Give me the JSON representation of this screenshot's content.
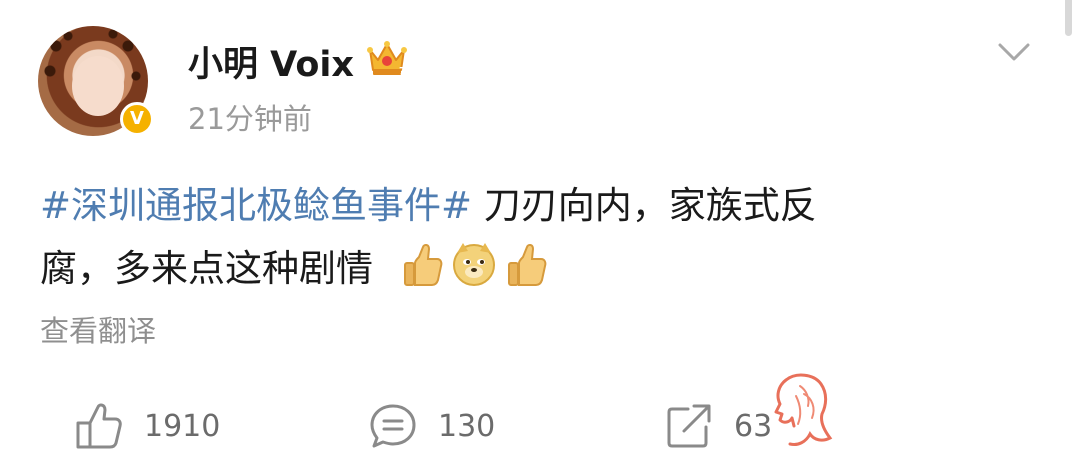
{
  "post": {
    "author": {
      "name": "小明 Voix",
      "verified_badge": "V",
      "crown_icon": "crown-icon"
    },
    "timestamp": "21分钟前",
    "content": {
      "hashtag": "#深圳通报北极鲶鱼事件#",
      "text_line1": " 刀刃向内，家族式反",
      "text_line2": "腐，多来点这种剧情",
      "emojis": [
        "thumbs-up-icon",
        "doge-icon",
        "thumbs-up-icon"
      ]
    },
    "translate_label": "查看翻译",
    "actions": {
      "like_count": "1910",
      "comment_count": "130",
      "share_count": "63"
    }
  },
  "colors": {
    "hashtag": "#4f7db1",
    "muted": "#9a9a9a",
    "verified": "#f5b100",
    "watermark": "#e8705a"
  }
}
